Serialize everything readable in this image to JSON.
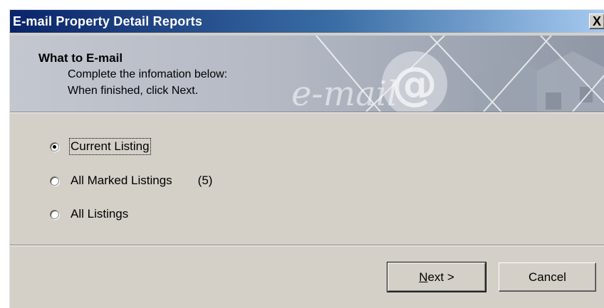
{
  "window": {
    "title": "E-mail Property Detail Reports",
    "close_symbol": "X"
  },
  "header": {
    "title": "What to E-mail",
    "line1": "Complete the infomation below:",
    "line2": "When finished, click Next.",
    "banner_text": "e-mail",
    "banner_icon": "at-sign-icon"
  },
  "options": [
    {
      "label": "Current Listing",
      "checked": true
    },
    {
      "label": "All Marked Listings",
      "checked": false,
      "count": "(5)"
    },
    {
      "label": "All Listings",
      "checked": false
    }
  ],
  "buttons": {
    "next_mnemonic": "N",
    "next_rest": "ext >",
    "cancel": "Cancel"
  }
}
